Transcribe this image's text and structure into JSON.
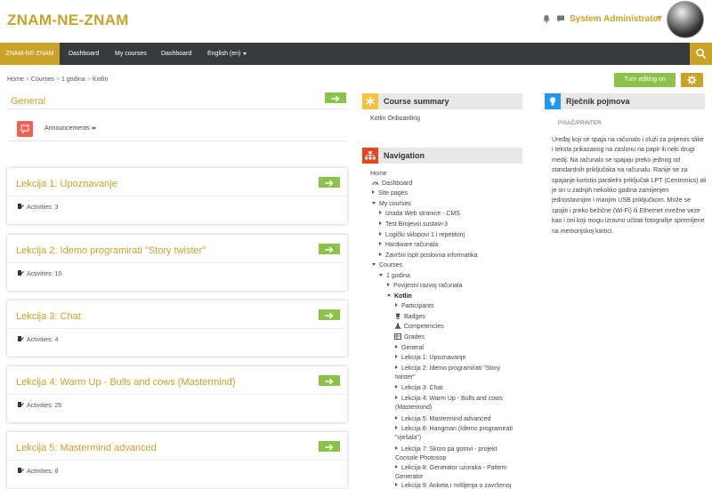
{
  "header": {
    "site_name": "ZNAM-NE-ZNAM",
    "user_name": "System Administrator"
  },
  "navbar": {
    "brand": "ZNAM-NE-ZNAM",
    "links": [
      "Dashboard",
      "My courses",
      "Dashboard",
      "English (en)"
    ]
  },
  "breadcrumb": [
    "Home",
    "Courses",
    "1 godina",
    "Kotlin"
  ],
  "actions": {
    "editing": "Turn editing on"
  },
  "general": {
    "title": "General",
    "announcements": "Announcements"
  },
  "lessons": [
    {
      "title": "Lekcija 1: Upoznavanje",
      "activities": "Activities: 3"
    },
    {
      "title": "Lekcija 2: Idemo programirati \"Story twister\"",
      "activities": "Activities: 10"
    },
    {
      "title": "Lekcija 3: Chat",
      "activities": "Activities: 4"
    },
    {
      "title": "Lekcija 4: Warm Up - Bulls and cows (Mastermind)",
      "activities": "Activities: 25"
    },
    {
      "title": "Lekcija 5: Mastermind advanced",
      "activities": "Activities: 8"
    }
  ],
  "course_summary": {
    "title": "Course summary",
    "text": "Kotlin Onboarding"
  },
  "navigation": {
    "title": "Navigation",
    "items": [
      "Home",
      "Dashboard",
      "Site pages",
      "My courses",
      "Izrada Web stranice - CMS",
      "Test Brojevni sustavi-3",
      "Logički sklopovi 1 i repetitorij",
      "Hardware računala",
      "Završni ispit poslovna informatika",
      "Courses",
      "1 godina",
      "Povijesni razvoj računala",
      "Kotlin",
      "Participants",
      "Badges",
      "Competencies",
      "Grades",
      "General",
      "Lekcija 1: Upoznavanje",
      "Lekcija 2: Idemo programirati \"Story twister\"",
      "Lekcija 3: Chat",
      "Lekcija 4: Warm Up - Bulls and cows (Mastermind)",
      "Lekcija 5: Mastermind advanced",
      "Lekcija 6: Hangman (Idemo programirati \"vješala\")",
      "Lekcija 7: Skoro pa gotovi - projekt Console Photosop",
      "Lekcija 8: Generator uzoraka - Pattern Generator",
      "Lekcija 9: Anketa i mišljenja o završenoj"
    ]
  },
  "glossary": {
    "title": "Rječnik pojmova",
    "concept": "PISAČ/PRINTER",
    "definition": "Uređaj koji se spaja na računalo i služi za prijenos slike i teksta prikazanog na zaslonu na papir ili neki drugi medij. Na računalo se spajaju preko jednog od standardnih priključaka na računalu. Ranije se za spajanje koristio paralelni priključak LPT (Centronics) ali je on u zadnjih nekoliko godina zamijenjen jednostavnijim i manjim USB priključkom. Može se spojiti i preko bežične (Wi-Fi) ili Ethernet mrežne veze kao i oni koji mogu izravno učitati fotografije spremljene na memorijskoj kartici."
  },
  "colors": {
    "accent": "#c9a227",
    "navbar": "#373a3c",
    "green": "#8bc34a",
    "announcement": "#f06353",
    "summary_icon": "#f4c33d",
    "navigation_icon": "#e8471e",
    "glossary_icon": "#2196f3"
  }
}
